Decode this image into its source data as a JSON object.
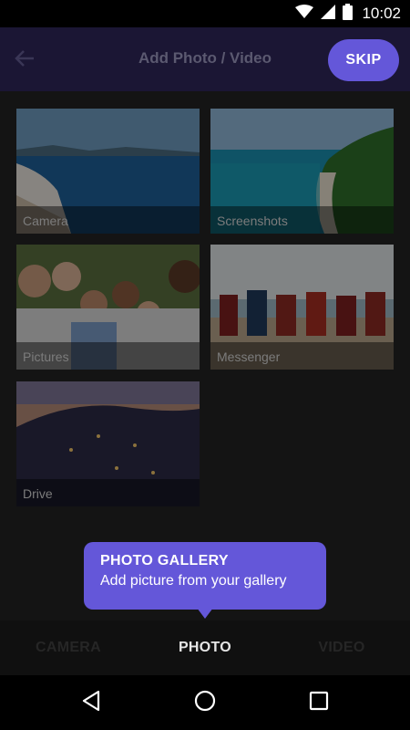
{
  "status_bar": {
    "time": "10:02",
    "icons": [
      "wifi-icon",
      "signal-icon",
      "battery-icon"
    ]
  },
  "header": {
    "back_icon": "arrow-left-icon",
    "title": "Add Photo / Video",
    "skip_label": "SKIP"
  },
  "albums": [
    {
      "label": "Camera"
    },
    {
      "label": "Screenshots"
    },
    {
      "label": "Pictures"
    },
    {
      "label": "Messenger"
    },
    {
      "label": "Drive"
    }
  ],
  "tooltip": {
    "title": "PHOTO GALLERY",
    "subtitle": "Add picture from your gallery"
  },
  "tabs": [
    {
      "label": "CAMERA",
      "active": false
    },
    {
      "label": "PHOTO",
      "active": true
    },
    {
      "label": "VIDEO",
      "active": false
    }
  ],
  "nav": {
    "icons": [
      "back-triangle-icon",
      "home-circle-icon",
      "recents-square-icon"
    ]
  },
  "colors": {
    "accent": "#6457d9",
    "appbar": "#1b1634",
    "content_bg": "#141414"
  }
}
